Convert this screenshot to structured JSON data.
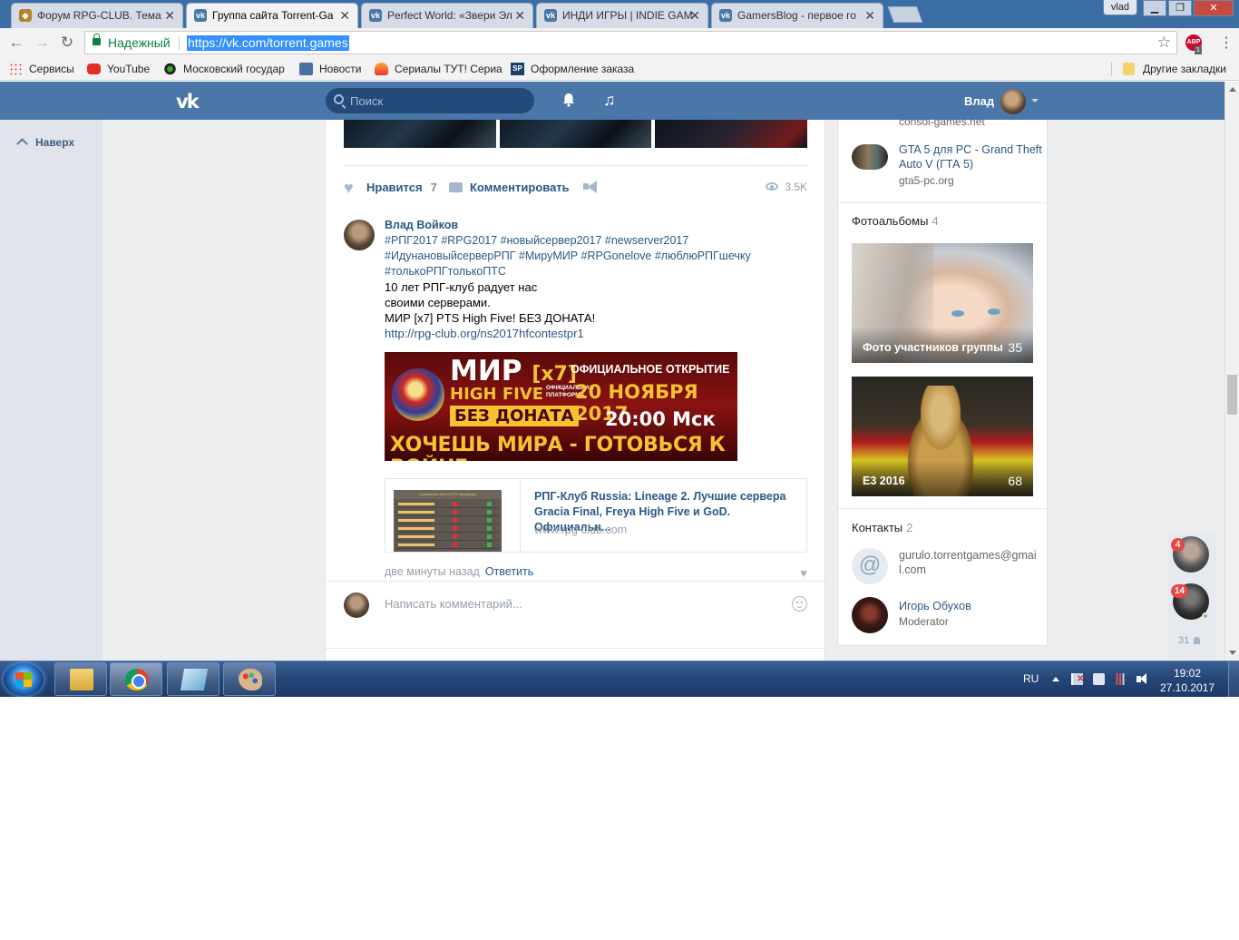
{
  "browser": {
    "tabs": [
      {
        "title": "Форум RPG-CLUB. Тема",
        "icon": "rpg-club-favicon",
        "active": false
      },
      {
        "title": "Группа сайта Torrent-Ga",
        "icon": "vk-favicon",
        "active": true
      },
      {
        "title": "Perfect World: «Звери Эл",
        "icon": "vk-favicon",
        "active": false
      },
      {
        "title": "ИНДИ ИГРЫ | INDIE GAM",
        "icon": "vk-favicon",
        "active": false
      },
      {
        "title": "GamersBlog - первое го",
        "icon": "vk-favicon",
        "active": false
      }
    ],
    "window_user": "vlad",
    "security_label": "Надежный",
    "url": "https://vk.com/torrent.games",
    "abp_badge": "ABP",
    "abp_count": "1",
    "bookmarks": [
      {
        "label": "Сервисы",
        "icon": "apps-grid-icon"
      },
      {
        "label": "YouTube",
        "icon": "youtube-icon"
      },
      {
        "label": "Московский государ",
        "icon": "emblem-icon"
      },
      {
        "label": "Новости",
        "icon": "play-icon"
      },
      {
        "label": "Сериалы ТУТ! Сериа",
        "icon": "flame-icon"
      },
      {
        "label": "Оформление заказа",
        "icon": "sp-icon"
      }
    ],
    "other_bookmarks": "Другие закладки"
  },
  "vk": {
    "search_placeholder": "Поиск",
    "user_name": "Влад",
    "back_to_top": "Наверх",
    "post": {
      "like_label": "Нравится",
      "like_count": "7",
      "comment_label": "Комментировать",
      "views": "3.5K"
    },
    "comment": {
      "author": "Влад Войков",
      "hashtags_line1": "#РПГ2017 #RPG2017 #новыйсервер2017 #newserver2017",
      "hashtags_line2": "#ИдунановыйсерверРПГ #МируМИР #RPGonelove #люблюРПГшечку",
      "hashtags_line3": "#толькоРПГтолькоПТС",
      "text_line1": "10 лет РПГ-клуб радует нас",
      "text_line2": "своими серверами.",
      "text_line3": "МИР [x7] PTS High Five! БЕЗ ДОНАТА!",
      "link": "http://rpg-club.org/ns2017hfcontestpr1",
      "banner": {
        "title": "МИР",
        "rate": "[x7]",
        "subtitle": "HIGH FIVE",
        "platform_line1": "ОФИЦИАЛЬНАЯ",
        "platform_line2": "ПЛАТФОРМА",
        "nodonate": "БЕЗ ДОНАТА",
        "opening": "ОФИЦИАЛЬНОЕ ОТКРЫТИЕ",
        "date": "20 НОЯБРЯ 2017",
        "time": "20:00 Мск",
        "slogan": "ХОЧЕШЬ МИРА - ГОТОВЬСЯ К ВОЙНЕ"
      },
      "card": {
        "title": "РПГ-Клуб Russia: Lineage 2. Лучшие сервера Gracia Final, Freya High Five и GoD. Официальн...",
        "domain": "www.rpg-club.com",
        "thumb_header": "Сравнение Java и PTS платформ"
      },
      "time": "две минуты назад",
      "reply": "Ответить"
    },
    "write_placeholder": "Написать комментарий..."
  },
  "sidebar": {
    "top_domain": "consol-games.net",
    "link_title": "GTA 5 для PC - Grand Theft Auto V (ГТА 5)",
    "link_domain": "gta5-pc.org",
    "albums_title": "Фотоальбомы",
    "albums_count": "4",
    "albums": [
      {
        "label": "Фото участников группы",
        "count": "35"
      },
      {
        "label": "E3 2016",
        "count": "68"
      }
    ],
    "contacts_title": "Контакты",
    "contacts_count": "2",
    "contacts": [
      {
        "line1": "gurulo.torrentgames@gmail.com",
        "line2": ""
      },
      {
        "line1": "Игорь Обухов",
        "line2": "Moderator"
      }
    ]
  },
  "chat": {
    "badge1": "4",
    "badge2": "14",
    "online_count": "31"
  },
  "taskbar": {
    "lang": "RU",
    "time": "19:02",
    "date": "27.10.2017"
  }
}
